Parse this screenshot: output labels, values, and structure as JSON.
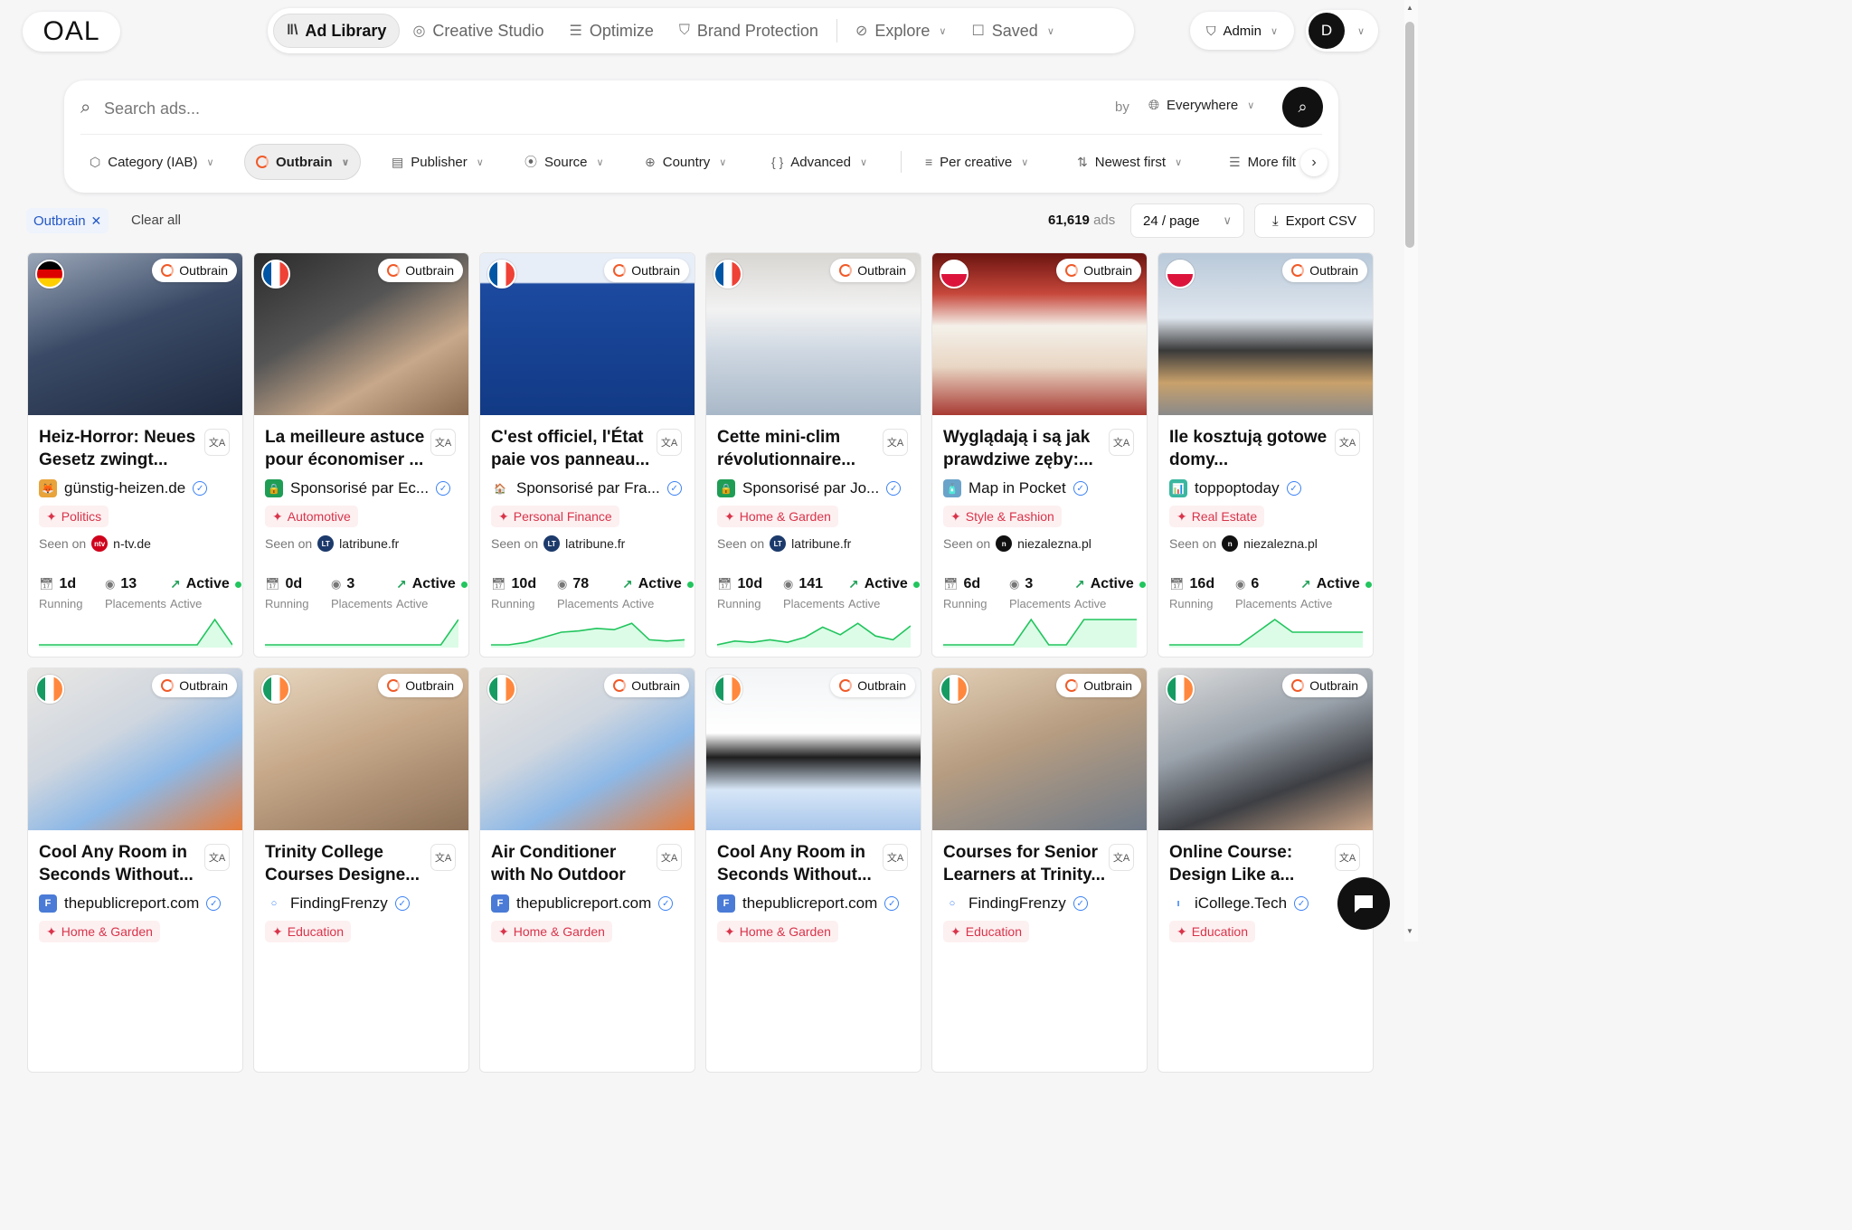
{
  "brand": {
    "logo_text": "OAL"
  },
  "nav": {
    "items": [
      {
        "label": "Ad Library",
        "icon": "library-icon",
        "active": true
      },
      {
        "label": "Creative Studio",
        "icon": "palette-icon"
      },
      {
        "label": "Optimize",
        "icon": "sliders-icon"
      },
      {
        "label": "Brand Protection",
        "icon": "shield-icon"
      },
      {
        "label": "Explore",
        "icon": "compass-icon",
        "dropdown": true
      },
      {
        "label": "Saved",
        "icon": "bookmark-icon",
        "dropdown": true
      }
    ]
  },
  "account": {
    "admin_label": "Admin",
    "avatar_initial": "D"
  },
  "search": {
    "placeholder": "Search ads...",
    "value": "",
    "by_label": "by",
    "scope": "Everywhere"
  },
  "filters": [
    {
      "label": "Category (IAB)",
      "icon": "tag-icon"
    },
    {
      "label": "Outbrain",
      "icon": "outbrain-icon",
      "selected": true
    },
    {
      "label": "Publisher",
      "icon": "newspaper-icon"
    },
    {
      "label": "Source",
      "icon": "broadcast-icon"
    },
    {
      "label": "Country",
      "icon": "globe-icon"
    },
    {
      "label": "Advanced",
      "icon": "braces-icon"
    },
    {
      "label": "Per creative",
      "icon": "layers-icon"
    },
    {
      "label": "Newest first",
      "icon": "sort-icon"
    },
    {
      "label": "More filt",
      "icon": "filter-sliders-icon"
    }
  ],
  "active_filters": {
    "chip": "Outbrain",
    "clear_label": "Clear all"
  },
  "results": {
    "count": "61,619",
    "count_suffix": "ads",
    "per_page": "24 / page",
    "export_label": "Export CSV"
  },
  "stat_labels": {
    "running": "Running",
    "placements": "Placements",
    "active": "Active",
    "seen_on": "Seen on"
  },
  "colors": {
    "accent_red": "#d8344a",
    "active_green": "#22c55e",
    "verified_blue": "#3b82f6",
    "network_orange": "#f05a28"
  },
  "cards": [
    {
      "flag": "de",
      "network": "Outbrain",
      "title": "Heiz-Horror: Neues Gesetz zwingt...",
      "advertiser": "günstig-heizen.de",
      "adv_logo_color": "#e8a33a",
      "adv_logo_char": "🦊",
      "category": "Politics",
      "publisher": "n-tv.de",
      "pub_logo_color": "#d0021b",
      "pub_logo_char": "ntv",
      "running": "1d",
      "placements": "13",
      "status": "Active",
      "spark": [
        0,
        0,
        0,
        0,
        0,
        0,
        0,
        0,
        0,
        0,
        1,
        0
      ]
    },
    {
      "flag": "fr",
      "network": "Outbrain",
      "title": "La meilleure astuce pour économiser ...",
      "advertiser": "Sponsorisé par Ec...",
      "adv_logo_color": "#1f9d55",
      "adv_logo_char": "🔒",
      "category": "Automotive",
      "publisher": "latribune.fr",
      "pub_logo_color": "#1c3a6b",
      "pub_logo_char": "LT",
      "running": "0d",
      "placements": "3",
      "status": "Active",
      "spark": [
        0,
        0,
        0,
        0,
        0,
        0,
        0,
        0,
        0,
        0,
        0,
        1
      ]
    },
    {
      "flag": "fr",
      "network": "Outbrain",
      "title": "C'est officiel, l'État paie vos panneau...",
      "advertiser": "Sponsorisé par Fra...",
      "adv_logo_color": "#ffffff",
      "adv_logo_char": "🏠",
      "category": "Personal Finance",
      "publisher": "latribune.fr",
      "pub_logo_color": "#1c3a6b",
      "pub_logo_char": "LT",
      "running": "10d",
      "placements": "78",
      "status": "Active",
      "spark": [
        0,
        0,
        0.1,
        0.3,
        0.5,
        0.55,
        0.65,
        0.6,
        0.85,
        0.2,
        0.15,
        0.2
      ]
    },
    {
      "flag": "fr",
      "network": "Outbrain",
      "title": "Cette mini-clim révolutionnaire...",
      "advertiser": "Sponsorisé par Jo...",
      "adv_logo_color": "#1f9d55",
      "adv_logo_char": "🔒",
      "category": "Home & Garden",
      "publisher": "latribune.fr",
      "pub_logo_color": "#1c3a6b",
      "pub_logo_char": "LT",
      "running": "10d",
      "placements": "141",
      "status": "Active",
      "spark": [
        0,
        0.15,
        0.1,
        0.2,
        0.1,
        0.3,
        0.7,
        0.4,
        0.85,
        0.35,
        0.2,
        0.75
      ]
    },
    {
      "flag": "pl",
      "network": "Outbrain",
      "title": "Wyglądają i są jak prawdziwe zęby:...",
      "advertiser": "Map in Pocket",
      "adv_logo_color": "#6aa3c9",
      "adv_logo_char": "🧴",
      "category": "Style & Fashion",
      "publisher": "niezalezna.pl",
      "pub_logo_color": "#111111",
      "pub_logo_char": "n",
      "running": "6d",
      "placements": "3",
      "status": "Active",
      "spark": [
        0,
        0,
        0,
        0,
        0,
        1,
        0,
        0,
        1,
        1,
        1,
        1
      ]
    },
    {
      "flag": "pl",
      "network": "Outbrain",
      "title": "Ile kosztują gotowe domy...",
      "advertiser": "toppoptoday",
      "adv_logo_color": "#3ab7a0",
      "adv_logo_char": "📊",
      "category": "Real Estate",
      "publisher": "niezalezna.pl",
      "pub_logo_color": "#111111",
      "pub_logo_char": "n",
      "running": "16d",
      "placements": "6",
      "status": "Active",
      "spark": [
        0,
        0,
        0,
        0,
        0,
        0.5,
        1,
        0.5,
        0.5,
        0.5,
        0.5,
        0.5
      ]
    },
    {
      "flag": "ie",
      "network": "Outbrain",
      "title": "Cool Any Room in Seconds Without...",
      "advertiser": "thepublicreport.com",
      "adv_logo_color": "#4a7bd6",
      "adv_logo_char": "F",
      "category": "Home & Garden"
    },
    {
      "flag": "ie",
      "network": "Outbrain",
      "title": "Trinity College Courses Designe...",
      "advertiser": "FindingFrenzy",
      "adv_logo_color": "#ffffff",
      "adv_logo_char": "○",
      "category": "Education"
    },
    {
      "flag": "ie",
      "network": "Outbrain",
      "title": "Air Conditioner with No Outdoor Unit for Just...",
      "advertiser": "thepublicreport.com",
      "adv_logo_color": "#4a7bd6",
      "adv_logo_char": "F",
      "category": "Home & Garden"
    },
    {
      "flag": "ie",
      "network": "Outbrain",
      "title": "Cool Any Room in Seconds Without...",
      "advertiser": "thepublicreport.com",
      "adv_logo_color": "#4a7bd6",
      "adv_logo_char": "F",
      "category": "Home & Garden"
    },
    {
      "flag": "ie",
      "network": "Outbrain",
      "title": "Courses for Senior Learners at Trinity...",
      "advertiser": "FindingFrenzy",
      "adv_logo_color": "#ffffff",
      "adv_logo_char": "○",
      "category": "Education"
    },
    {
      "flag": "ie",
      "network": "Outbrain",
      "title": "Online Course: Design Like a...",
      "advertiser": "iCollege.Tech",
      "adv_logo_color": "#ffffff",
      "adv_logo_char": "ı",
      "category": "Education"
    }
  ]
}
